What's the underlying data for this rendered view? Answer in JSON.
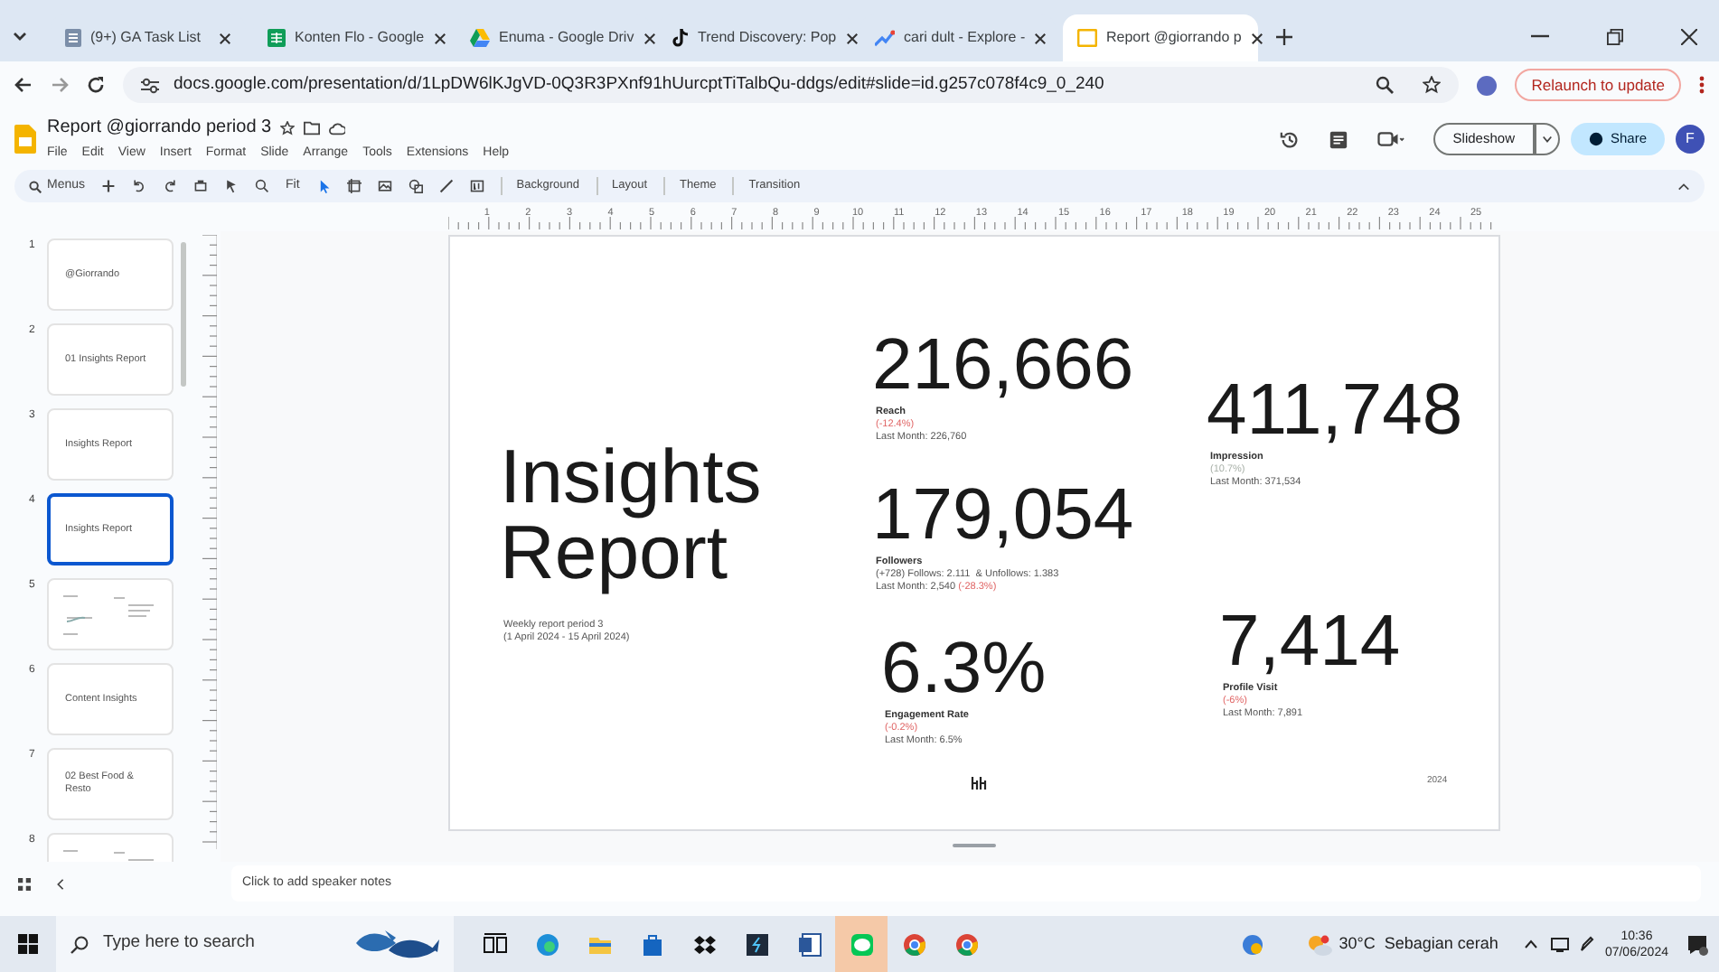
{
  "browser": {
    "tabs": [
      {
        "title": "(9+) GA Task List",
        "selected": false
      },
      {
        "title": "Konten Flo - Google",
        "selected": false
      },
      {
        "title": "Enuma - Google Driv",
        "selected": false
      },
      {
        "title": "Trend Discovery: Pop",
        "selected": false
      },
      {
        "title": "cari dult - Explore -",
        "selected": false
      },
      {
        "title": "Report @giorrando p",
        "selected": true
      }
    ],
    "url": "docs.google.com/presentation/d/1LpDW6lKJgVD-0Q3R3PXnf91hUurcptTiTalbQu-ddgs/edit#slide=id.g257c078f4c9_0_240",
    "relaunch_button": "Relaunch to update"
  },
  "doc": {
    "title": "Report @giorrando period 3",
    "menus": [
      "File",
      "Edit",
      "View",
      "Insert",
      "Format",
      "Slide",
      "Arrange",
      "Tools",
      "Extensions",
      "Help"
    ],
    "toolbar": {
      "search": "Menus",
      "zoom": "Fit",
      "buttons": [
        "Background",
        "Layout",
        "Theme",
        "Transition"
      ]
    },
    "slideshow_button": "Slideshow",
    "share_button": "Share",
    "avatar": "F"
  },
  "ruler_marks": [
    "1",
    "2",
    "3",
    "4",
    "5",
    "6",
    "7",
    "8",
    "9",
    "10",
    "11",
    "12",
    "13",
    "14",
    "15",
    "16",
    "17",
    "18",
    "19",
    "20",
    "21",
    "22",
    "23",
    "24",
    "25"
  ],
  "filmstrip": [
    {
      "number": "1",
      "title": "@Giorrando",
      "selected": false
    },
    {
      "number": "2",
      "title": "01  Insights Report",
      "selected": false
    },
    {
      "number": "3",
      "title": "Insights Report",
      "selected": false
    },
    {
      "number": "4",
      "title": "Insights Report",
      "selected": true
    },
    {
      "number": "5",
      "selected": false
    },
    {
      "number": "6",
      "title": "Content Insights",
      "selected": false
    },
    {
      "number": "7",
      "title": "02  Best Food & Resto",
      "selected": false
    },
    {
      "number": "8",
      "selected": false
    }
  ],
  "slide": {
    "title": "Insights Report",
    "subtitle_lines": [
      "Weekly report period 3",
      "(1 April 2024 - 15 April 2024)"
    ],
    "stats": [
      {
        "value": "216,666",
        "label": "Reach",
        "details": [
          [
            {
              "text": "(-12.4%)",
              "color": "#e06666"
            }
          ],
          [
            {
              "text": "Last Month: 226,760"
            }
          ]
        ]
      },
      {
        "value": "179,054",
        "label": "Followers",
        "details": [
          [
            {
              "text": "(+728) Follows: 2.111  & Unfollows: 1.383"
            }
          ],
          [
            {
              "text": "Last Month: 2,540 "
            },
            {
              "text": "(-28.3%)",
              "color": "#e06666"
            }
          ]
        ]
      },
      {
        "value": "6.3%",
        "label": "Engagement Rate",
        "details": [
          [
            {
              "text": "(-0.2%)",
              "color": "#e06666"
            }
          ],
          [
            {
              "text": "Last Month: 6.5%"
            }
          ]
        ]
      },
      {
        "value": "411,748",
        "label": "Impression",
        "details": [
          [
            {
              "text": "(10.7%)",
              "color": "#a8b0a8"
            }
          ],
          [
            {
              "text": "Last Month: 371,534"
            }
          ]
        ]
      },
      {
        "value": "7,414",
        "label": "Profile Visit",
        "details": [
          [
            {
              "text": "(-6%)",
              "color": "#e06666"
            }
          ],
          [
            {
              "text": "Last Month: 7,891"
            }
          ]
        ]
      }
    ],
    "footer_year": "2024"
  },
  "speaker_notes": {
    "placeholder": "Click to add speaker notes"
  },
  "taskbar": {
    "search_placeholder": "Type here to search",
    "weather": "30°C  Sebagian cerah",
    "time": "10:36",
    "date": "07/06/2024"
  }
}
